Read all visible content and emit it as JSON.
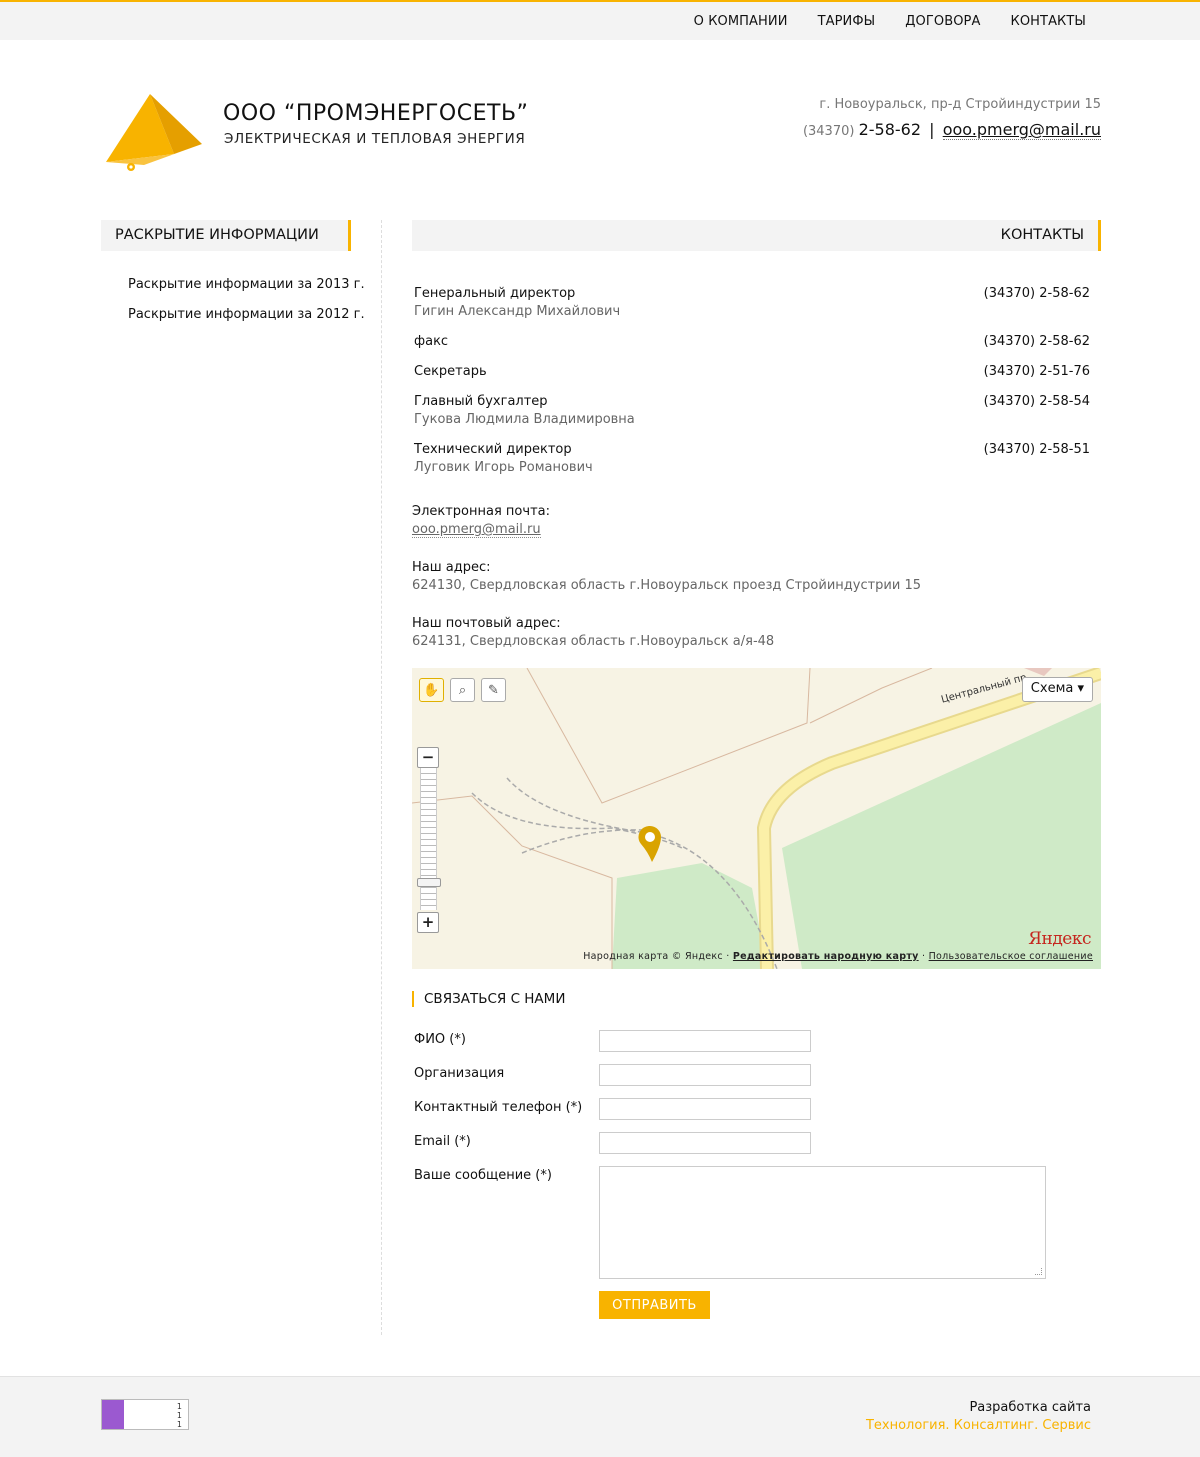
{
  "nav": {
    "items": [
      "О КОМПАНИИ",
      "ТАРИФЫ",
      "ДОГОВОРА",
      "КОНТАКТЫ"
    ]
  },
  "brand": {
    "title": "ООО “ПРОМЭНЕРГОСЕТЬ”",
    "subtitle": "ЭЛЕКТРИЧЕСКАЯ И ТЕПЛОВАЯ ЭНЕРГИЯ",
    "accent_color": "#f8b300"
  },
  "header_contact": {
    "address": "г. Новоуральск, пр-д Стройиндустрии 15",
    "code": "(34370)",
    "phone": "2-58-62",
    "separator": "|",
    "email": "ooo.pmerg@mail.ru"
  },
  "sidebar": {
    "title": "РАСКРЫТИЕ ИНФОРМАЦИИ",
    "items": [
      "Раскрытие информации за 2013 г.",
      "Раскрытие информации за 2012 г."
    ]
  },
  "main": {
    "title": "КОНТАКТЫ",
    "contacts": [
      {
        "role": "Генеральный директор",
        "person": "Гигин Александр Михайлович",
        "phone": "(34370) 2-58-62"
      },
      {
        "role": "факс",
        "person": "",
        "phone": "(34370) 2-58-62"
      },
      {
        "role": "Секретарь",
        "person": "",
        "phone": "(34370) 2-51-76"
      },
      {
        "role": "Главный бухгалтер",
        "person": "Гукова Людмила Владимировна",
        "phone": "(34370) 2-58-54"
      },
      {
        "role": "Технический директор",
        "person": "Луговик Игорь Романович",
        "phone": "(34370) 2-58-51"
      }
    ],
    "email_label": "Электронная почта:",
    "email_value": "ooo.pmerg@mail.ru",
    "address_label": "Наш адрес:",
    "address_value": "624130, Свердловская область г.Новоуральск проезд Стройиндустрии 15",
    "postal_label": "Наш почтовый адрес:",
    "postal_value": "624131, Свердловская область г.Новоуральск а/я-48"
  },
  "map": {
    "type_label": "Схема ▾",
    "road_label": "Центральный пр",
    "logo": "Яндекс",
    "copyright_prefix": "Народная карта © Яндекс ·",
    "edit_link": "Редактировать народную карту",
    "dot": "·",
    "terms_link": "Пользовательское соглашение",
    "zoom_minus": "−",
    "zoom_plus": "+",
    "icons": [
      "hand-icon",
      "magnifier-icon",
      "ruler-icon"
    ]
  },
  "form": {
    "title": "СВЯЗАТЬСЯ С НАМИ",
    "fio_label": "ФИО (*)",
    "org_label": "Организация",
    "phone_label": "Контактный телефон (*)",
    "email_label": "Email (*)",
    "message_label": "Ваше сообщение (*)",
    "submit_label": "ОТПРАВИТЬ"
  },
  "footer": {
    "counter_lines": [
      "1",
      "1",
      "1"
    ],
    "dev_line1": "Разработка сайта",
    "dev_line2": "Технология. Консалтинг. Сервис"
  }
}
